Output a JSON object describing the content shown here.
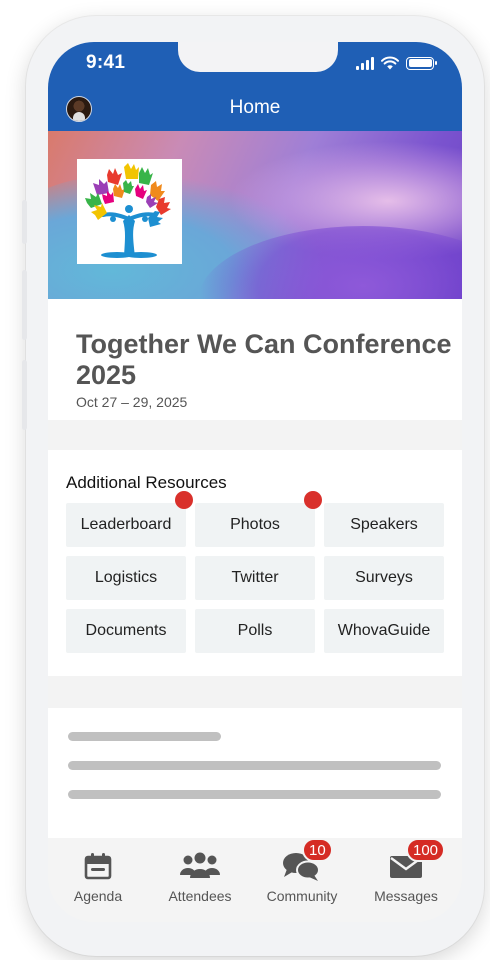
{
  "status_bar": {
    "time": "9:41"
  },
  "header": {
    "title": "Home",
    "avatar_icon": "user-avatar",
    "color": "#1f5fb5"
  },
  "event": {
    "title": "Together We Can Conference 2025",
    "date": "Oct 27 – 29, 2025",
    "logo_icon": "hands-tree-logo"
  },
  "resources": {
    "title": "Additional Resources",
    "items": [
      {
        "label": "Leaderboard",
        "has_dot": true
      },
      {
        "label": "Photos",
        "has_dot": true
      },
      {
        "label": "Speakers",
        "has_dot": false
      },
      {
        "label": "Logistics",
        "has_dot": false
      },
      {
        "label": "Twitter",
        "has_dot": false
      },
      {
        "label": "Surveys",
        "has_dot": false
      },
      {
        "label": "Documents",
        "has_dot": false
      },
      {
        "label": "Polls",
        "has_dot": false
      },
      {
        "label": "WhovaGuide",
        "has_dot": false
      }
    ]
  },
  "nav": {
    "items": [
      {
        "label": "Agenda",
        "icon": "calendar-icon",
        "badge": ""
      },
      {
        "label": "Attendees",
        "icon": "people-icon",
        "badge": ""
      },
      {
        "label": "Community",
        "icon": "chat-bubbles-icon",
        "badge": "10"
      },
      {
        "label": "Messages",
        "icon": "envelope-icon",
        "badge": "100"
      }
    ],
    "badge_color": "#d52b24"
  },
  "colors": {
    "accent": "#1f5fb5",
    "notification_dot": "#d9302b"
  }
}
